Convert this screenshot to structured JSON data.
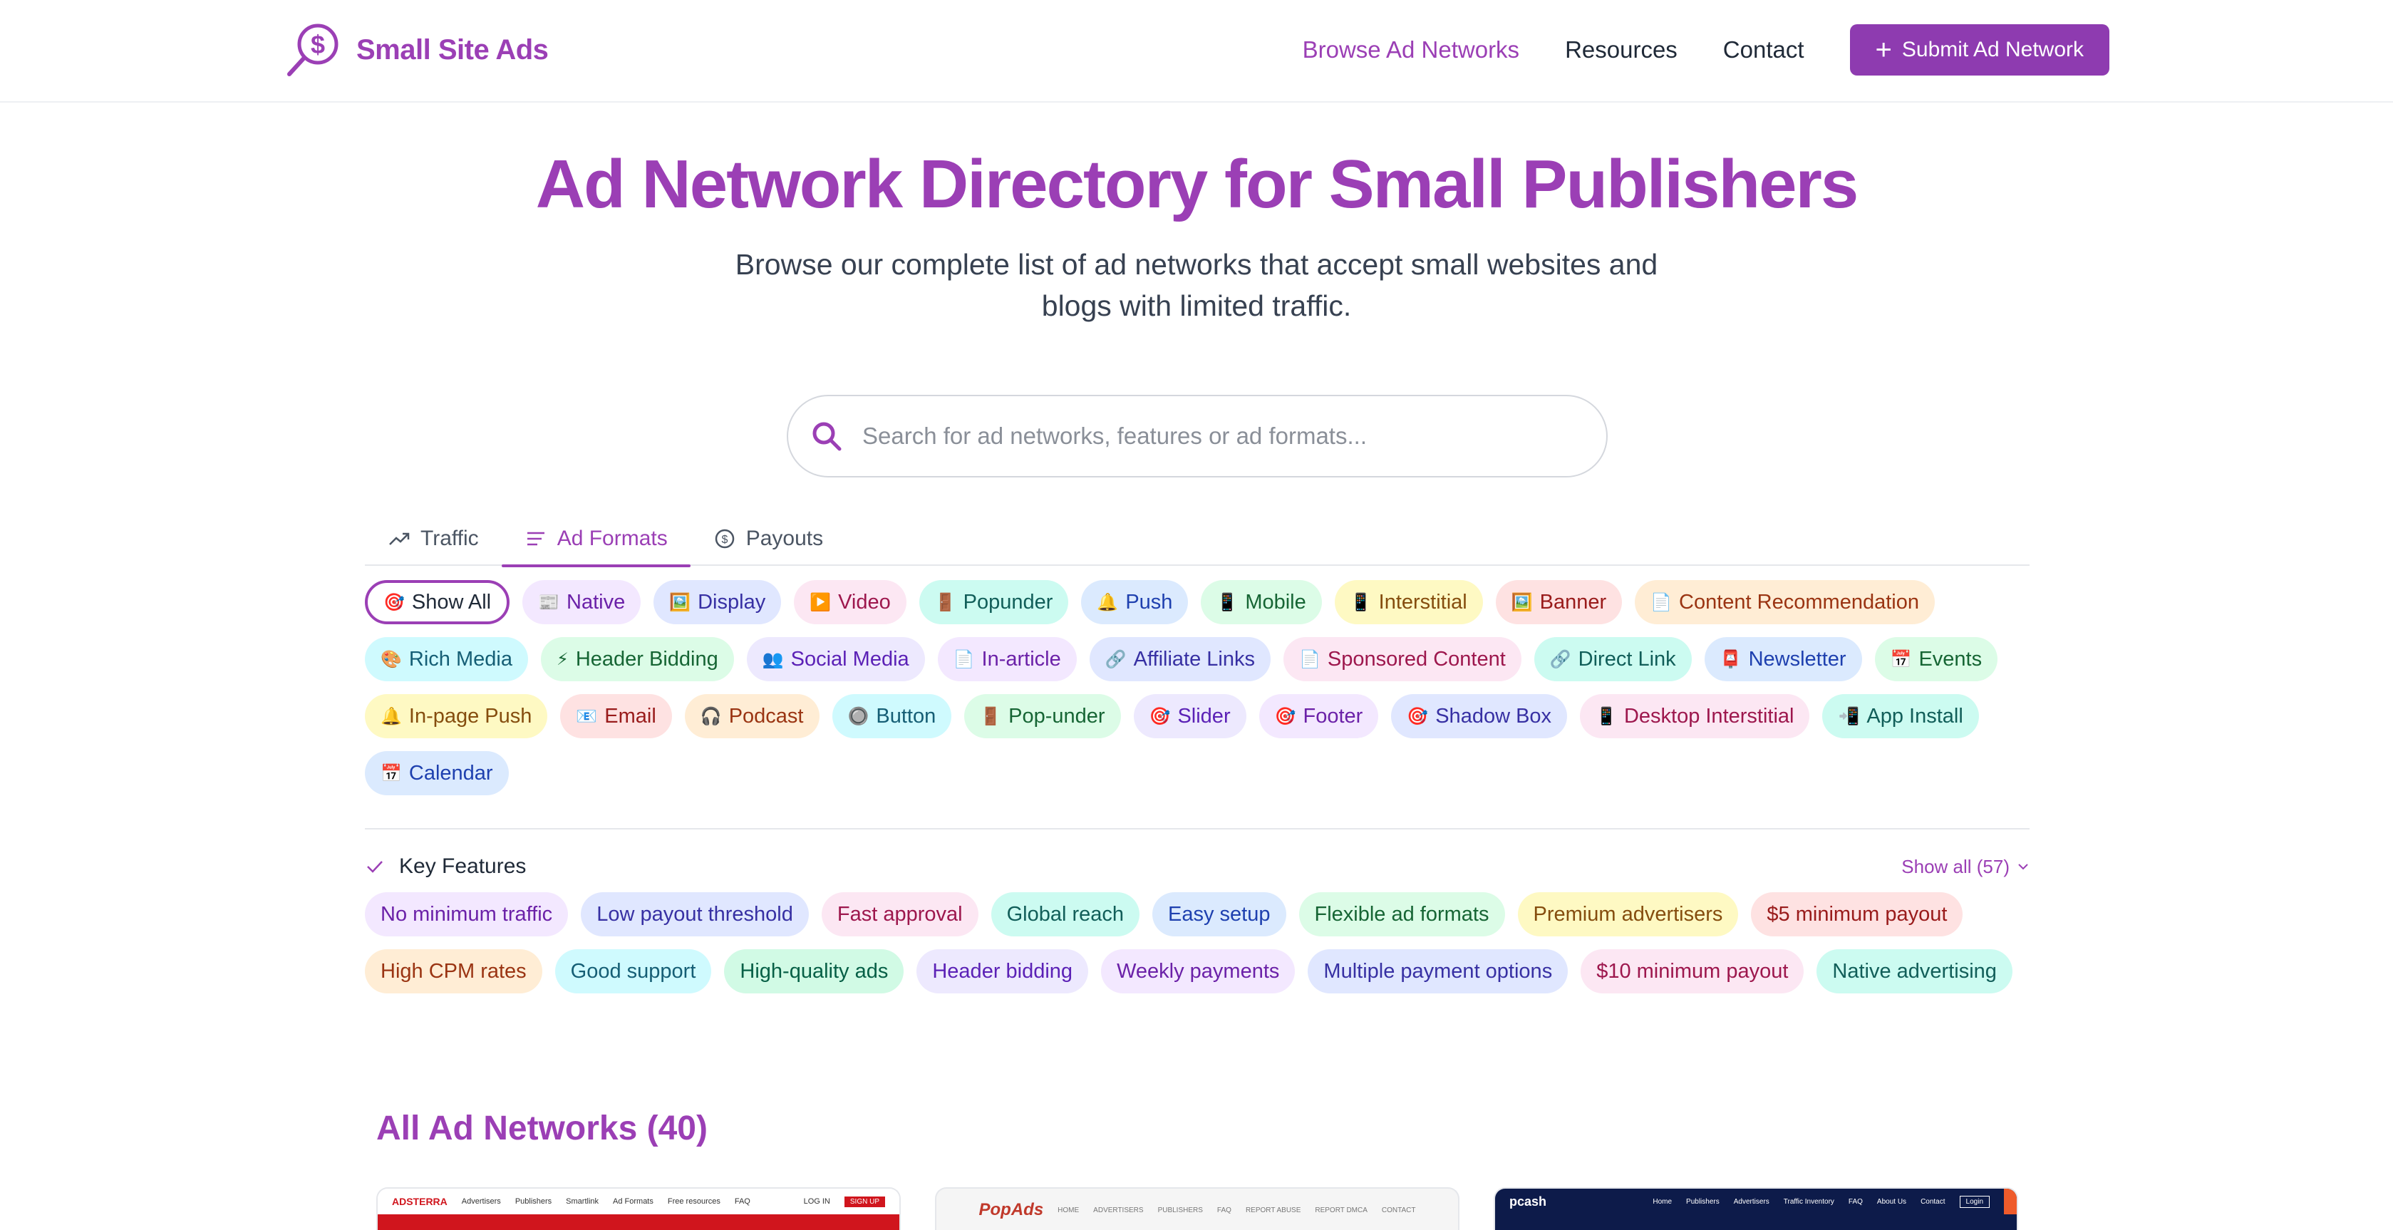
{
  "header": {
    "brand": "Small Site Ads",
    "nav": [
      {
        "label": "Browse Ad Networks",
        "active": true
      },
      {
        "label": "Resources",
        "active": false
      },
      {
        "label": "Contact",
        "active": false
      }
    ],
    "submit_label": "Submit Ad Network"
  },
  "hero": {
    "title": "Ad Network Directory for Small Publishers",
    "subtitle": "Browse our complete list of ad networks that accept small websites and blogs with limited traffic."
  },
  "search": {
    "placeholder": "Search for ad networks, features or ad formats..."
  },
  "tabs": [
    {
      "label": "Traffic",
      "icon": "trending-up-icon",
      "active": false
    },
    {
      "label": "Ad Formats",
      "icon": "list-icon",
      "active": true
    },
    {
      "label": "Payouts",
      "icon": "dollar-circle-icon",
      "active": false
    }
  ],
  "ad_formats": [
    {
      "emoji": "🎯",
      "label": "Show All",
      "color": "selected"
    },
    {
      "emoji": "📰",
      "label": "Native",
      "color": "purple"
    },
    {
      "emoji": "🖼️",
      "label": "Display",
      "color": "indigo"
    },
    {
      "emoji": "▶️",
      "label": "Video",
      "color": "pink"
    },
    {
      "emoji": "🚪",
      "label": "Popunder",
      "color": "teal"
    },
    {
      "emoji": "🔔",
      "label": "Push",
      "color": "blue"
    },
    {
      "emoji": "📱",
      "label": "Mobile",
      "color": "green"
    },
    {
      "emoji": "📱",
      "label": "Interstitial",
      "color": "yellow"
    },
    {
      "emoji": "🖼️",
      "label": "Banner",
      "color": "red"
    },
    {
      "emoji": "📄",
      "label": "Content Recommendation",
      "color": "orange"
    },
    {
      "emoji": "🎨",
      "label": "Rich Media",
      "color": "cyan"
    },
    {
      "emoji": "⚡",
      "label": "Header Bidding",
      "color": "green"
    },
    {
      "emoji": "👥",
      "label": "Social Media",
      "color": "violet"
    },
    {
      "emoji": "📄",
      "label": "In-article",
      "color": "purple"
    },
    {
      "emoji": "🔗",
      "label": "Affiliate Links",
      "color": "indigo"
    },
    {
      "emoji": "📄",
      "label": "Sponsored Content",
      "color": "pink"
    },
    {
      "emoji": "🔗",
      "label": "Direct Link",
      "color": "teal"
    },
    {
      "emoji": "📮",
      "label": "Newsletter",
      "color": "blue"
    },
    {
      "emoji": "📅",
      "label": "Events",
      "color": "green"
    },
    {
      "emoji": "🔔",
      "label": "In-page Push",
      "color": "yellow"
    },
    {
      "emoji": "📧",
      "label": "Email",
      "color": "red"
    },
    {
      "emoji": "🎧",
      "label": "Podcast",
      "color": "orange"
    },
    {
      "emoji": "🔘",
      "label": "Button",
      "color": "cyan"
    },
    {
      "emoji": "🚪",
      "label": "Pop-under",
      "color": "green"
    },
    {
      "emoji": "🎯",
      "label": "Slider",
      "color": "violet"
    },
    {
      "emoji": "🎯",
      "label": "Footer",
      "color": "purple"
    },
    {
      "emoji": "🎯",
      "label": "Shadow Box",
      "color": "indigo"
    },
    {
      "emoji": "📱",
      "label": "Desktop Interstitial",
      "color": "pink"
    },
    {
      "emoji": "📲",
      "label": "App Install",
      "color": "teal"
    },
    {
      "emoji": "📅",
      "label": "Calendar",
      "color": "blue"
    }
  ],
  "key_features": {
    "title": "Key Features",
    "show_all": "Show all (57)",
    "items": [
      {
        "label": "No minimum traffic",
        "color": "purple"
      },
      {
        "label": "Low payout threshold",
        "color": "indigo"
      },
      {
        "label": "Fast approval",
        "color": "pink"
      },
      {
        "label": "Global reach",
        "color": "teal"
      },
      {
        "label": "Easy setup",
        "color": "blue"
      },
      {
        "label": "Flexible ad formats",
        "color": "green"
      },
      {
        "label": "Premium advertisers",
        "color": "yellow"
      },
      {
        "label": "$5 minimum payout",
        "color": "red"
      },
      {
        "label": "High CPM rates",
        "color": "orange"
      },
      {
        "label": "Good support",
        "color": "cyan"
      },
      {
        "label": "High-quality ads",
        "color": "emerald"
      },
      {
        "label": "Header bidding",
        "color": "violet"
      },
      {
        "label": "Weekly payments",
        "color": "purple"
      },
      {
        "label": "Multiple payment options",
        "color": "indigo"
      },
      {
        "label": "$10 minimum payout",
        "color": "pink"
      },
      {
        "label": "Native advertising",
        "color": "teal"
      }
    ]
  },
  "networks": {
    "title": "All Ad Networks (40)",
    "cards": [
      {
        "brand": "ADSTERRA",
        "links": [
          "Advertisers",
          "Publishers",
          "Smartlink",
          "Ad Formats",
          "Free resources",
          "FAQ"
        ],
        "login": "LOG IN",
        "cta": "SIGN UP"
      },
      {
        "brand": "PopAds",
        "links": [
          "HOME",
          "ADVERTISERS",
          "PUBLISHERS",
          "FAQ",
          "REPORT ABUSE",
          "REPORT DMCA",
          "CONTACT"
        ]
      },
      {
        "brand": "pcash",
        "links": [
          "Home",
          "Publishers",
          "Advertisers",
          "Traffic Inventory",
          "FAQ",
          "About Us",
          "Contact"
        ],
        "login": "Login"
      }
    ]
  },
  "colors": {
    "accent": "#9b3fb5",
    "button": "#8e3bb0"
  }
}
